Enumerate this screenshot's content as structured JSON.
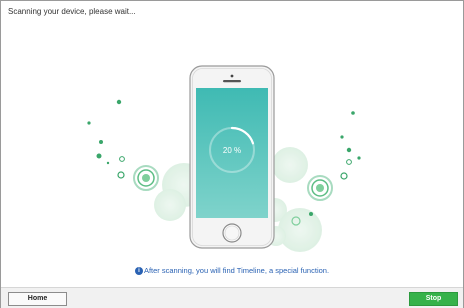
{
  "header": {
    "status_text": "Scanning your device, please wait..."
  },
  "scan": {
    "progress_label": "20 %",
    "progress_fraction": 0.2
  },
  "tip": {
    "text": "After scanning, you will find Timeline, a special function."
  },
  "footer": {
    "home_label": "Home",
    "stop_label": "Stop"
  },
  "colors": {
    "accent_green": "#36b24a",
    "teal": "#5cc4ba",
    "tip_blue": "#2a62b3"
  },
  "icons": {
    "tip_icon": "info-icon"
  }
}
